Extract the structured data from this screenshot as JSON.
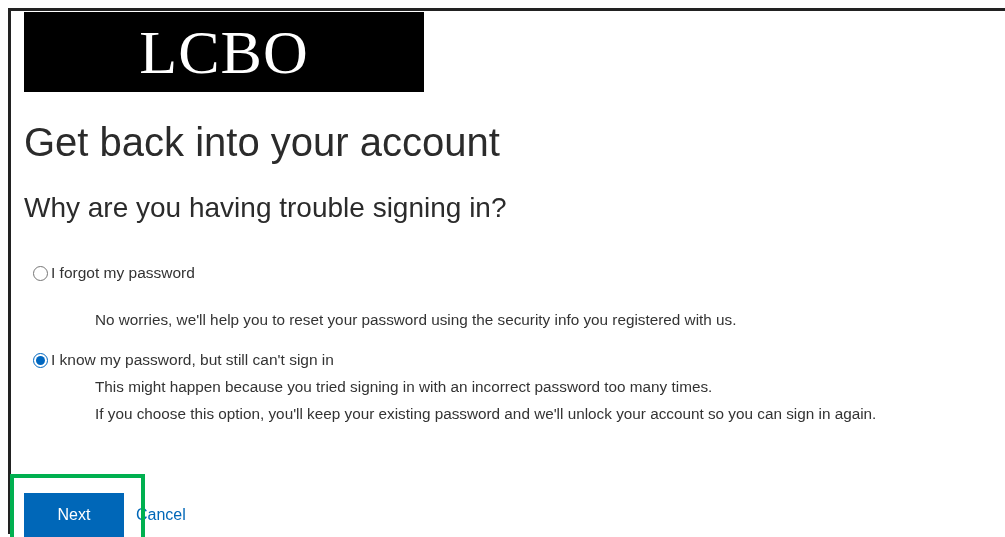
{
  "logo": {
    "text": "LCBO"
  },
  "title": "Get back into your account",
  "subtitle": "Why are you having trouble signing in?",
  "options": [
    {
      "label": "I forgot my password",
      "selected": false,
      "description": [
        "No worries, we'll help you to reset your password using the security info you registered with us."
      ]
    },
    {
      "label": "I know my password, but still can't sign in",
      "selected": true,
      "description": [
        "This might happen because you tried signing in with an incorrect password too many times.",
        "If you choose this option, you'll keep your existing password and we'll unlock your account so you can sign in again."
      ]
    }
  ],
  "buttons": {
    "next": "Next",
    "cancel": "Cancel"
  }
}
